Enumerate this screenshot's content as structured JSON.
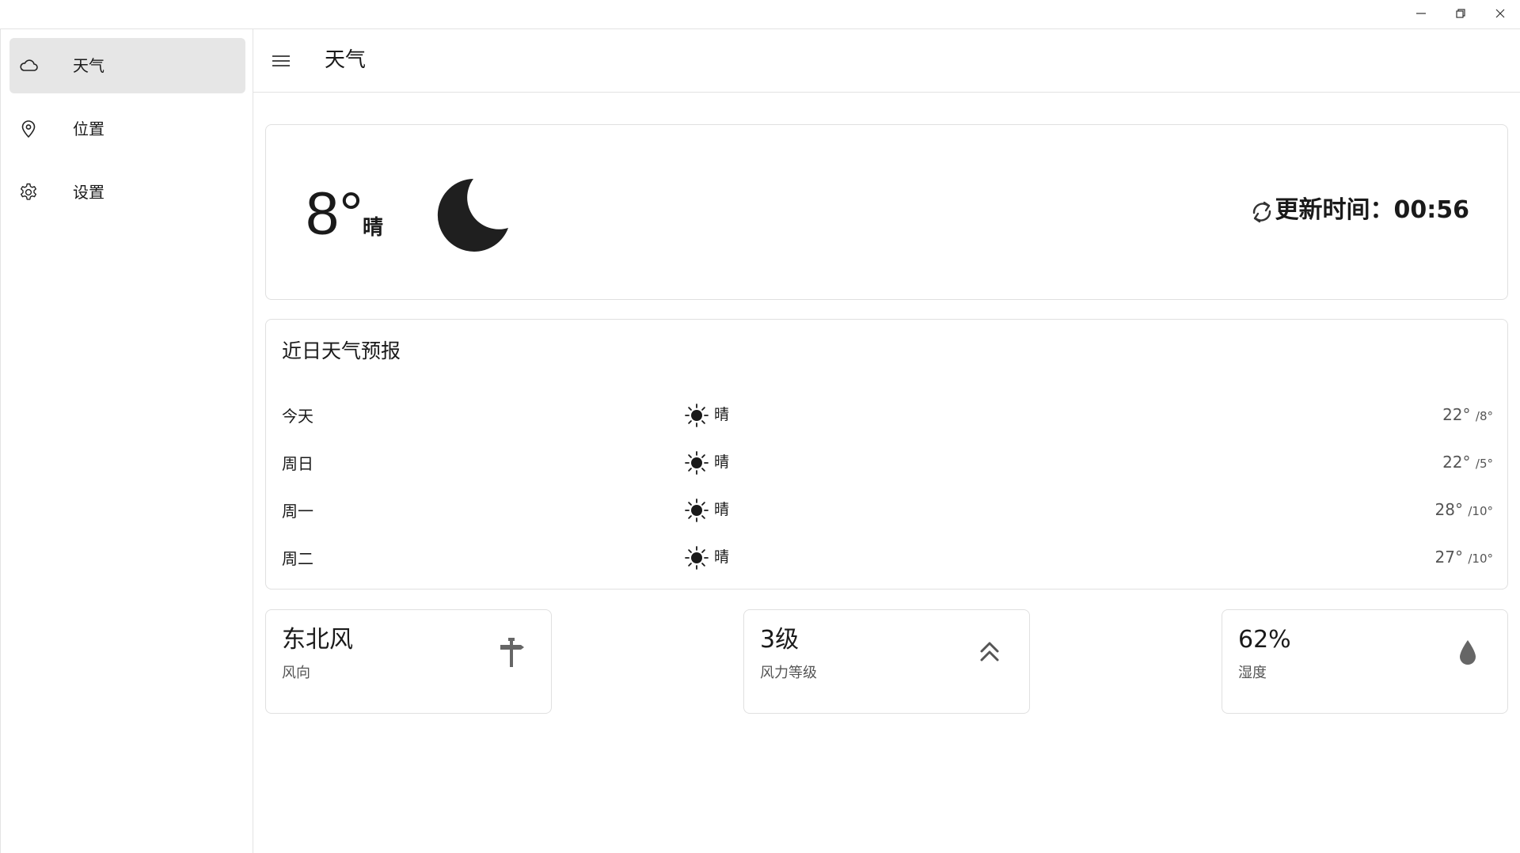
{
  "window": {
    "controls": {
      "minimize_icon": "minimize-icon",
      "maximize_icon": "restore-icon",
      "close_icon": "close-icon"
    }
  },
  "sidebar": {
    "items": [
      {
        "label": "天气",
        "icon": "cloud-icon",
        "active": true
      },
      {
        "label": "位置",
        "icon": "location-pin-icon",
        "active": false
      },
      {
        "label": "设置",
        "icon": "gear-icon",
        "active": false
      }
    ]
  },
  "header": {
    "title": "天气",
    "menu_icon": "hamburger-icon"
  },
  "current": {
    "temperature": "8°",
    "condition": "晴",
    "condition_icon": "moon-icon",
    "update_text": "更新时间：00:56",
    "update_icon": "sync-icon"
  },
  "forecast": {
    "title": "近日天气预报",
    "days": [
      {
        "day": "今天",
        "condition": "晴",
        "icon": "sun-icon",
        "high": "22°",
        "low": "/8°"
      },
      {
        "day": "周日",
        "condition": "晴",
        "icon": "sun-icon",
        "high": "22°",
        "low": "/5°"
      },
      {
        "day": "周一",
        "condition": "晴",
        "icon": "sun-icon",
        "high": "28°",
        "low": "/10°"
      },
      {
        "day": "周二",
        "condition": "晴",
        "icon": "sun-icon",
        "high": "27°",
        "low": "/10°"
      }
    ]
  },
  "stats": {
    "wind_direction": {
      "value": "东北风",
      "label": "风向",
      "icon": "signpost-icon"
    },
    "wind_level": {
      "value": "3级",
      "label": "风力等级",
      "icon": "double-chevron-up-icon"
    },
    "humidity": {
      "value": "62%",
      "label": "湿度",
      "icon": "water-drop-icon"
    }
  },
  "colors": {
    "accent_active_bg": "#e6e6e6",
    "border": "#e0e0e0",
    "text_primary": "#1a1a1a",
    "text_secondary": "#555555"
  }
}
